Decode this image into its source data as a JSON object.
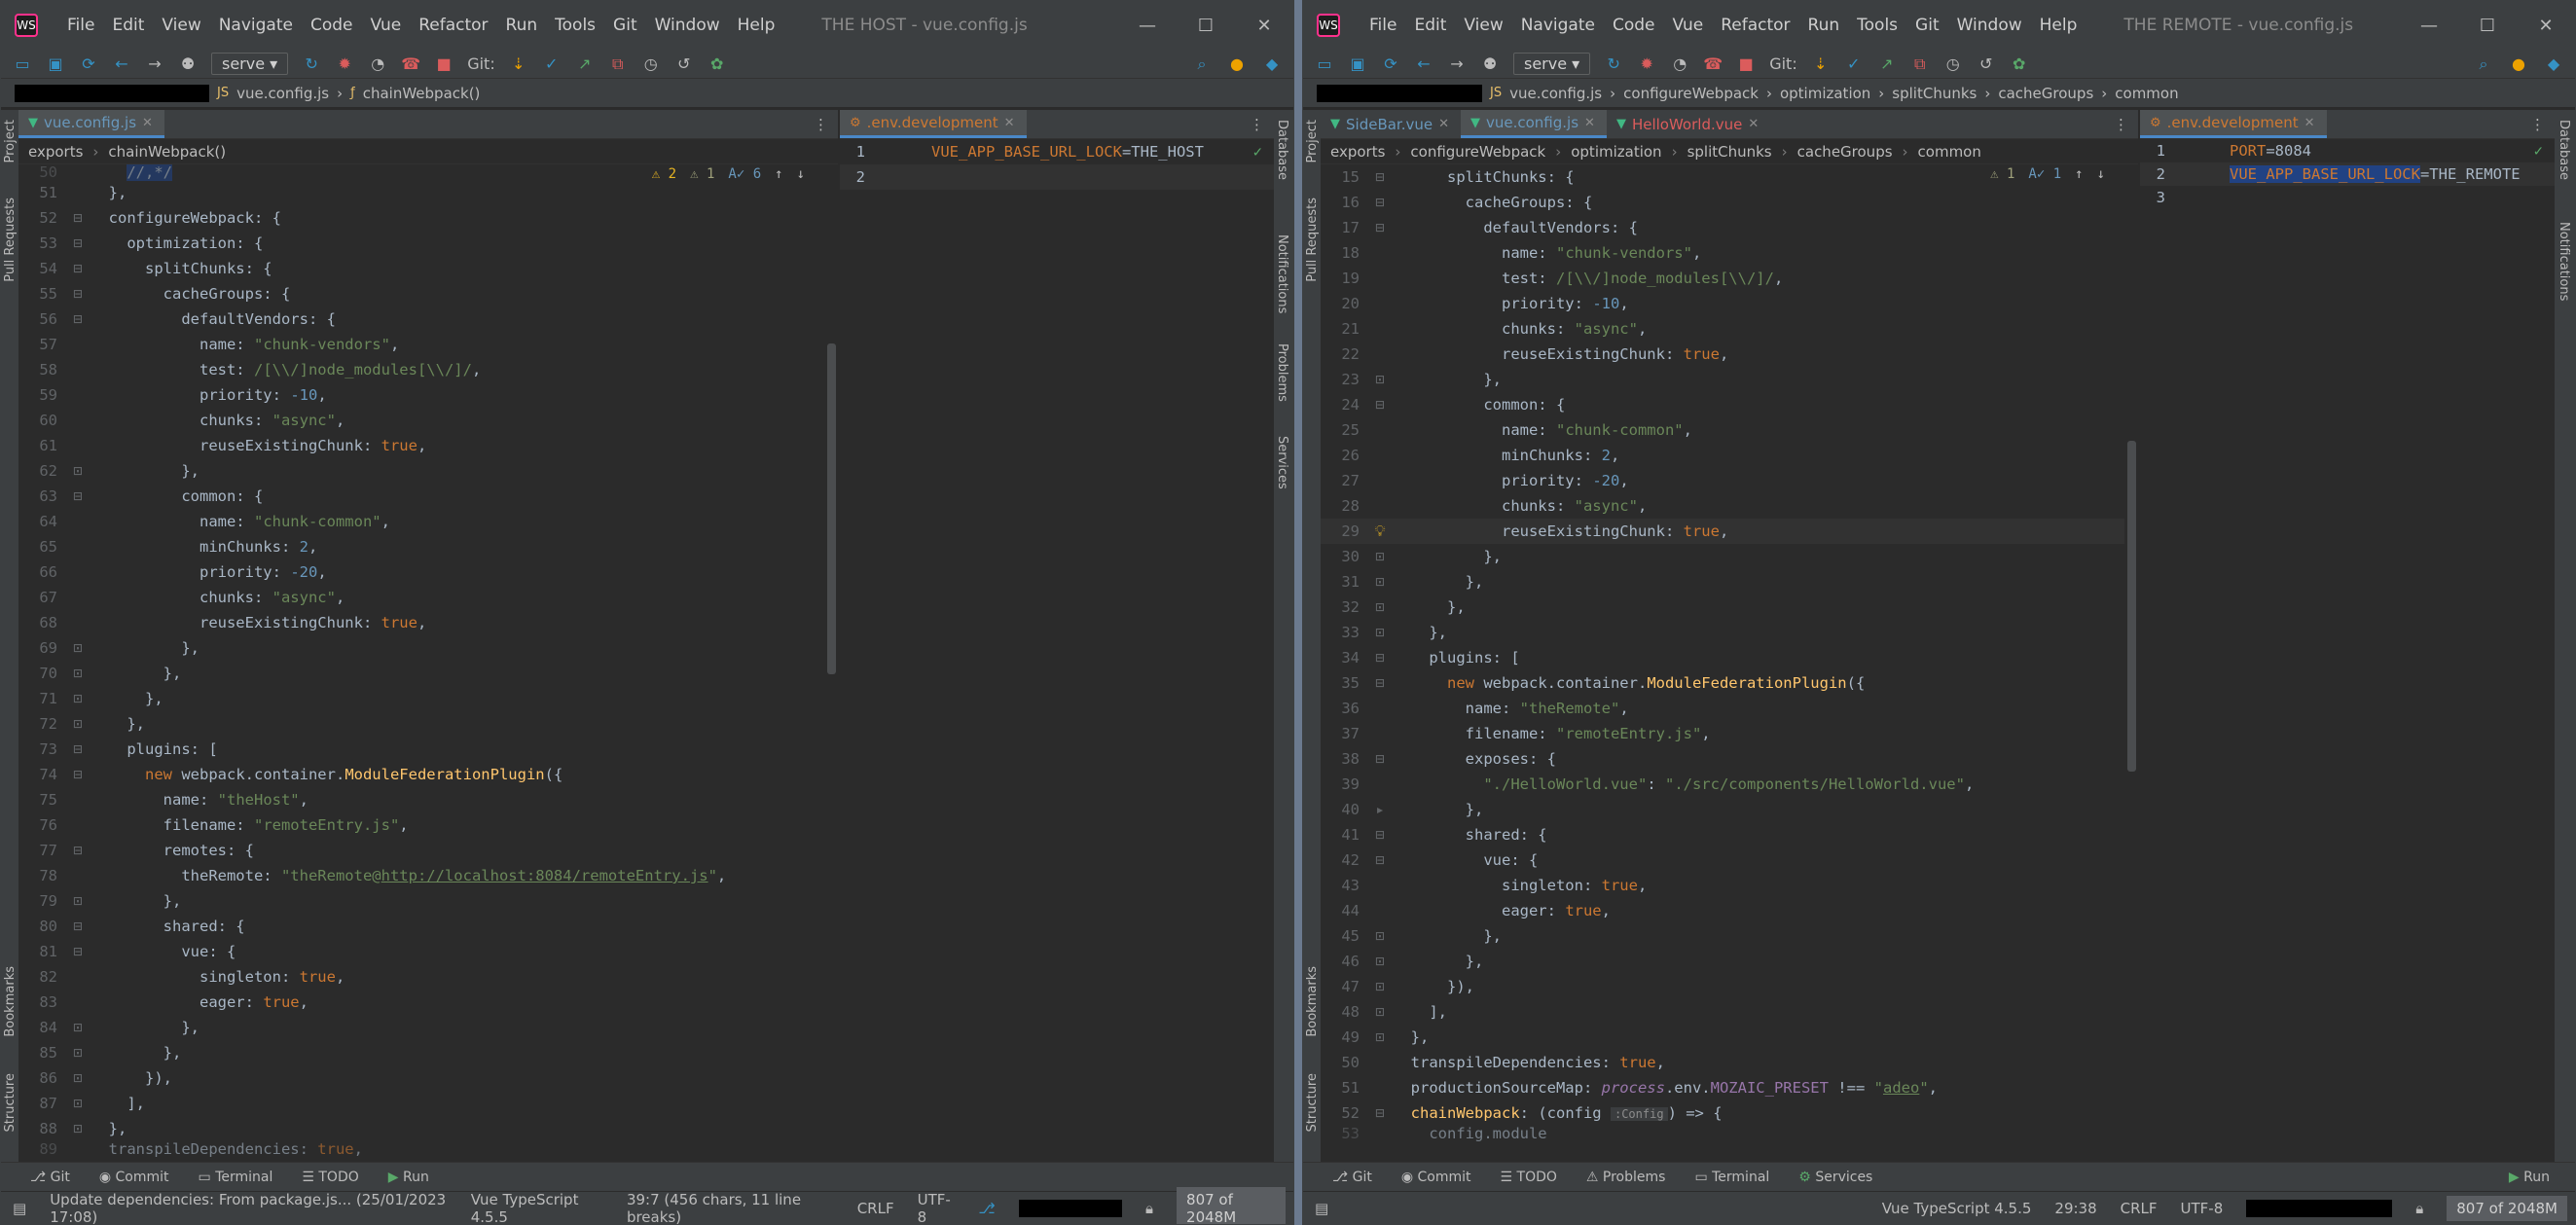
{
  "menu": [
    "File",
    "Edit",
    "View",
    "Navigate",
    "Code",
    "Vue",
    "Refactor",
    "Run",
    "Tools",
    "Git",
    "Window",
    "Help"
  ],
  "toolbar": {
    "run_config": "serve",
    "git_label": "Git:"
  },
  "left": {
    "window_title": "THE HOST - vue.config.js",
    "nav": {
      "file": "vue.config.js",
      "func": "chainWebpack()"
    },
    "tabs": [
      {
        "label": "vue.config.js"
      }
    ],
    "env_tab": ".env.development",
    "breadcrumb": [
      "exports",
      "chainWebpack()"
    ],
    "inspections": {
      "warnings": "2",
      "weak": "1",
      "typos": "6"
    },
    "env_lines": [
      {
        "n": "1",
        "key": "VUE_APP_BASE_URL_LOCK",
        "val": "=THE_HOST"
      },
      {
        "n": "2",
        "key": "",
        "val": ""
      }
    ],
    "bottom_tools": [
      "Git",
      "Commit",
      "Terminal",
      "TODO",
      "Run"
    ],
    "status": {
      "message": "Update dependencies: From package.js... (25/01/2023 17:08)",
      "lang": "Vue TypeScript 4.5.5",
      "pos": "39:7 (456 chars, 11 line breaks)",
      "eol": "CRLF",
      "enc": "UTF-8",
      "mem": "807 of 2048M"
    },
    "strip_left": [
      "Project",
      "Pull Requests",
      "Bookmarks",
      "Structure"
    ],
    "strip_right": [
      "Database",
      "Notifications",
      "Problems",
      "Services"
    ]
  },
  "right": {
    "window_title": "THE REMOTE - vue.config.js",
    "nav": {
      "file": "vue.config.js",
      "crumbs": [
        "configureWebpack",
        "optimization",
        "splitChunks",
        "cacheGroups",
        "common"
      ]
    },
    "tabs": [
      {
        "label": "SideBar.vue"
      },
      {
        "label": "vue.config.js"
      },
      {
        "label": "HelloWorld.vue"
      }
    ],
    "env_tab": ".env.development",
    "breadcrumb": [
      "exports",
      "configureWebpack",
      "optimization",
      "splitChunks",
      "cacheGroups",
      "common"
    ],
    "inspections": {
      "weak": "1",
      "typos": "1"
    },
    "env_lines": [
      {
        "n": "1",
        "key": "PORT",
        "val": "=8084"
      },
      {
        "n": "2",
        "key": "VUE_APP_BASE_URL_LOCK",
        "val": "=THE_REMOTE"
      },
      {
        "n": "3",
        "key": "",
        "val": ""
      }
    ],
    "bottom_tools": [
      "Git",
      "Commit",
      "TODO",
      "Problems",
      "Terminal",
      "Services",
      "Run"
    ],
    "status": {
      "lang": "Vue TypeScript 4.5.5",
      "pos": "29:38",
      "eol": "CRLF",
      "enc": "UTF-8",
      "mem": "807 of 2048M"
    },
    "strip_left": [
      "Project",
      "Pull Requests",
      "Bookmarks",
      "Structure"
    ],
    "strip_right": [
      "Database",
      "Notifications"
    ]
  }
}
